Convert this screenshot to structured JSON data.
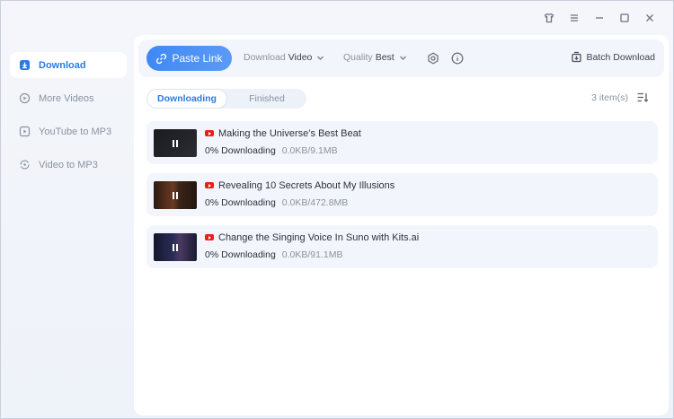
{
  "titlebar": {
    "icons": [
      "shirt-icon",
      "menu-icon",
      "minimize-icon",
      "maximize-icon",
      "close-icon"
    ]
  },
  "sidebar": {
    "items": [
      {
        "label": "Download",
        "icon": "download-icon",
        "active": true
      },
      {
        "label": "More Videos",
        "icon": "play-circle-icon",
        "active": false
      },
      {
        "label": "YouTube to MP3",
        "icon": "play-square-icon",
        "active": false
      },
      {
        "label": "Video to MP3",
        "icon": "convert-icon",
        "active": false
      }
    ]
  },
  "toolbar": {
    "paste_label": "Paste Link",
    "download_label": "Download",
    "download_value": "Video",
    "quality_label": "Quality",
    "quality_value": "Best",
    "batch_label": "Batch Download"
  },
  "tabs": [
    {
      "label": "Downloading",
      "active": true
    },
    {
      "label": "Finished",
      "active": false
    }
  ],
  "item_count": "3 item(s)",
  "downloads": [
    {
      "title": "Making the Universe’s Best Beat",
      "percent": "0%",
      "status": "Downloading",
      "size": "0.0KB/9.1MB"
    },
    {
      "title": "Revealing 10 Secrets About My Illusions",
      "percent": "0%",
      "status": "Downloading",
      "size": "0.0KB/472.8MB"
    },
    {
      "title": "Change the Singing Voice In Suno with Kits.ai",
      "percent": "0%",
      "status": "Downloading",
      "size": "0.0KB/91.1MB"
    }
  ],
  "colors": {
    "accent": "#2b7be0",
    "paste_button": "#4a90f6",
    "youtube_red": "#e62117"
  }
}
